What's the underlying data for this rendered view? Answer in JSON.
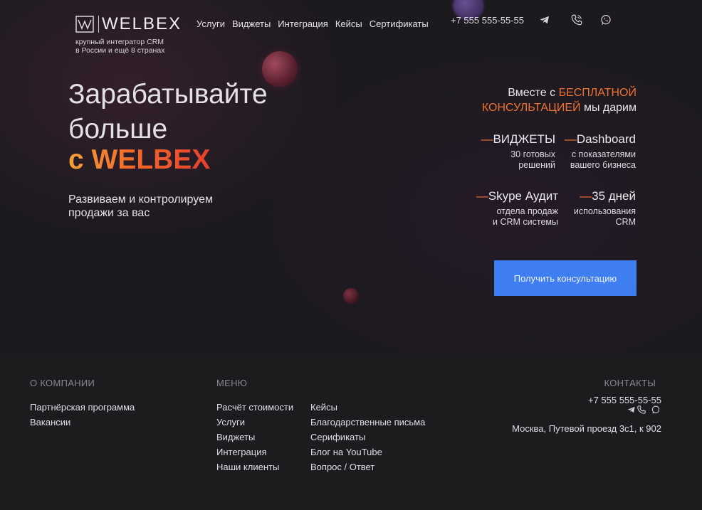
{
  "header": {
    "logo_word": "WELBEX",
    "logo_subtitle_line1": "крупный интегратор CRM",
    "logo_subtitle_line2": "в России и ещё 8 странах",
    "nav": [
      "Услуги",
      "Виджеты",
      "Интеграция",
      "Кейсы",
      "Сертификаты"
    ],
    "phone": "+7 555 555-55-55",
    "icons": [
      "telegram-icon",
      "phone-call-icon",
      "whatsapp-icon"
    ]
  },
  "hero": {
    "title_line1": "Зарабатывайте",
    "title_line2": "больше",
    "title_brand": "с WELBEX",
    "lead_line1": "Развиваем и контролируем",
    "lead_line2": "продажи за вас",
    "offer_prefix": "Вместе с ",
    "offer_accent1": "БЕСПЛАТНОЙ",
    "offer_accent2": "КОНСУЛЬТАЦИЕЙ",
    "offer_suffix": " мы дарим",
    "features": [
      {
        "title": "ВИДЖЕТЫ",
        "desc1": "30 готовых",
        "desc2": "решений"
      },
      {
        "title": "Dashboard",
        "desc1": "с показателями",
        "desc2": "вашего бизнеса"
      },
      {
        "title": "Skype Аудит",
        "desc1": "отдела продаж",
        "desc2": "и CRM системы"
      },
      {
        "title": "35 дней",
        "desc1": "использования",
        "desc2": "CRM"
      }
    ],
    "cta_label": "Получить консультацию"
  },
  "footer": {
    "company_heading": "О КОМПАНИИ",
    "company_links": [
      "Партнёрская программа",
      "Вакансии"
    ],
    "menu_heading": "МЕНЮ",
    "menu_col1": [
      "Расчёт стоимости",
      "Услуги",
      "Виджеты",
      "Интеграция",
      "Наши клиенты"
    ],
    "menu_col2": [
      "Кейсы",
      "Благодарственные письма",
      "Серификаты",
      "Блог на YouTube",
      "Вопрос / Ответ"
    ],
    "contacts_heading": "КОНТАКТЫ",
    "phone": "+7 555 555-55-55",
    "address": "Москва, Путевой проезд 3с1, к 902"
  },
  "colors": {
    "accent_orange": "#f0722e",
    "cta_blue": "#3f7ef0",
    "background": "#1c1a1d"
  }
}
